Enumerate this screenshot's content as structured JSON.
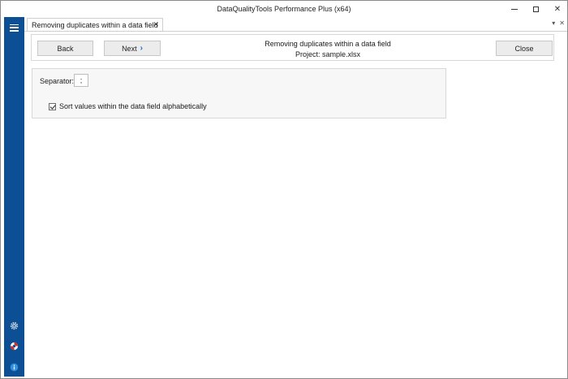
{
  "window": {
    "title": "DataQualityTools Performance Plus (x64)",
    "controls": {
      "minimize": "—",
      "close": "✕"
    }
  },
  "sidebar": {
    "icons": [
      "hamburger-icon",
      "gear-icon",
      "lifebuoy-icon",
      "info-icon"
    ]
  },
  "tab": {
    "label": "Removing duplicates within a data field",
    "close_glyph": "✕",
    "tools": {
      "dropdown": "▾",
      "close": "✕"
    }
  },
  "toolbar": {
    "back_label": "Back",
    "next_label": "Next",
    "next_chevron": "›",
    "close_label": "Close",
    "heading": "Removing duplicates within a data field",
    "project": "Project: sample.xlsx"
  },
  "options": {
    "separator_label": "Separator:",
    "separator_value": ";",
    "sort_label": "Sort values within the data field alphabetically",
    "sort_checked": true
  },
  "colors": {
    "sidebar": "#0c4f94",
    "accent": "#1a6fbf",
    "lifebuoy": "#d9261c"
  }
}
